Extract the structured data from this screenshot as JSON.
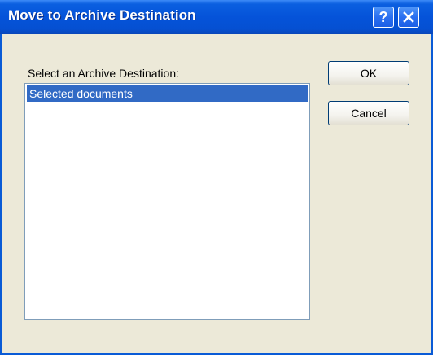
{
  "window": {
    "title": "Move to Archive Destination",
    "help_glyph": "?",
    "help_icon": "help-icon",
    "close_icon": "close-icon"
  },
  "dialog": {
    "prompt_label": "Select an Archive Destination:",
    "list_items": [
      {
        "label": "Selected documents",
        "selected": true
      }
    ],
    "ok_label": "OK",
    "cancel_label": "Cancel"
  },
  "colors": {
    "titlebar": "#0553d9",
    "selection": "#316ac5",
    "dialog_bg": "#ece9d8"
  }
}
